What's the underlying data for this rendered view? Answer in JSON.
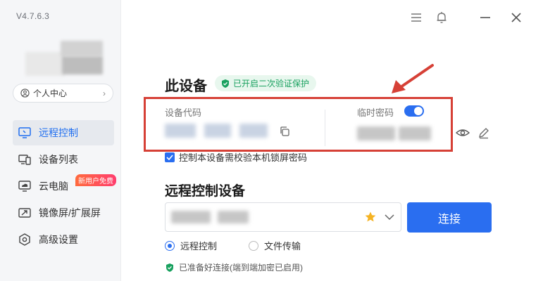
{
  "app": {
    "version": "V4.7.6.3"
  },
  "sidebar": {
    "profile_label": "个人中心",
    "items": [
      {
        "label": "远程控制",
        "icon": "remote-control-icon",
        "active": true
      },
      {
        "label": "设备列表",
        "icon": "device-list-icon",
        "active": false
      },
      {
        "label": "云电脑",
        "icon": "cloud-pc-icon",
        "active": false,
        "badge": "新用户免费"
      },
      {
        "label": "镜像屏/扩展屏",
        "icon": "mirror-screen-icon",
        "active": false
      },
      {
        "label": "高级设置",
        "icon": "settings-icon",
        "active": false
      }
    ]
  },
  "header": {
    "icons": [
      "menu-icon",
      "bell-icon",
      "minimize-icon",
      "close-icon"
    ]
  },
  "this_device": {
    "title": "此设备",
    "verify_badge": "已开启二次验证保护",
    "device_code_label": "设备代码",
    "temp_password_label": "临时密码",
    "temp_password_enabled": true,
    "lock_password_checkbox": "控制本设备需校验本机锁屏密码",
    "lock_password_checked": true
  },
  "remote": {
    "title": "远程控制设备",
    "connect_label": "连接",
    "modes": [
      {
        "label": "远程控制",
        "selected": true
      },
      {
        "label": "文件传输",
        "selected": false
      }
    ],
    "status": "已准备好连接(端到端加密已启用)"
  },
  "colors": {
    "accent": "#2a6ef0",
    "annotation_red": "#d64036",
    "success_green": "#19a15f",
    "badge_orange": "#ff5a4a"
  }
}
